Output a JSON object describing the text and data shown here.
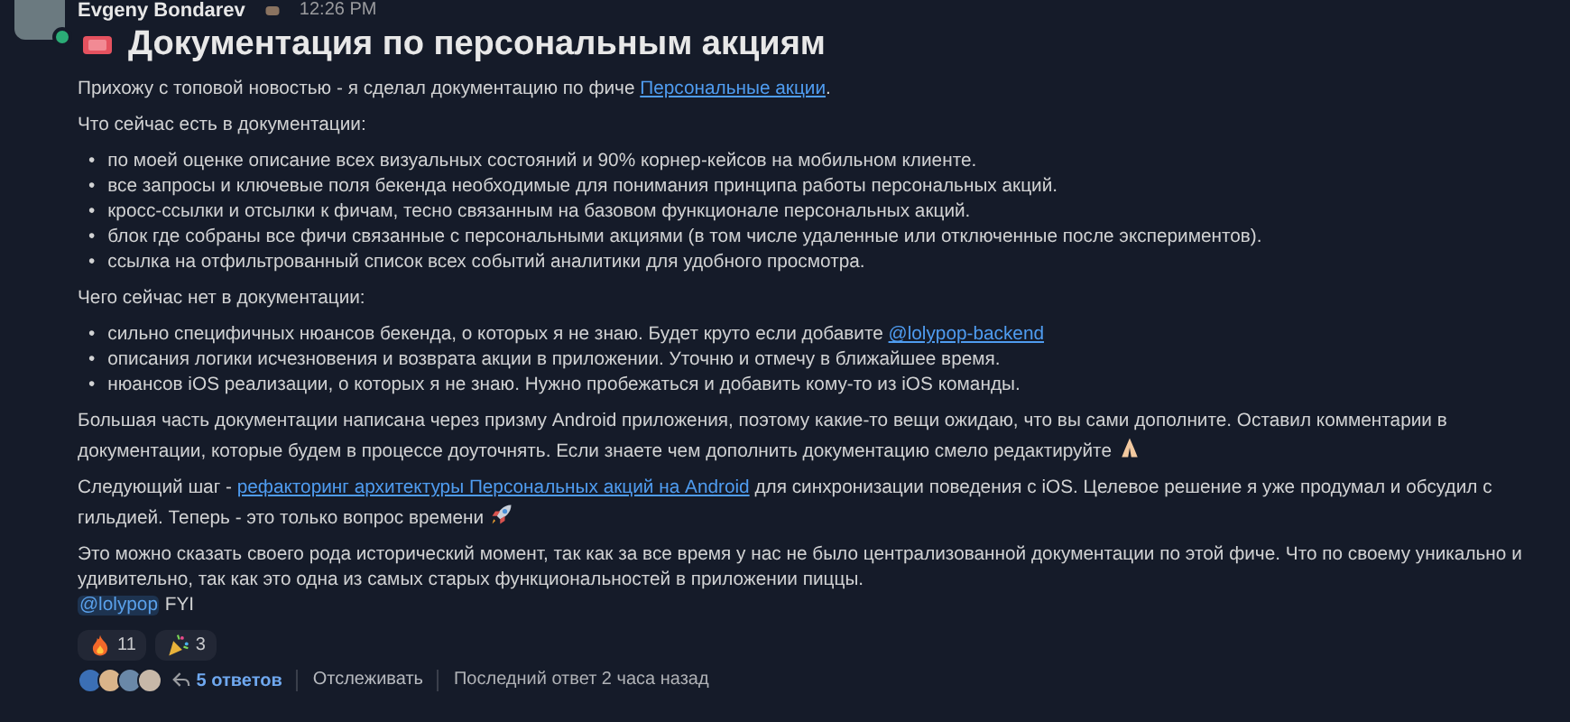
{
  "message": {
    "author": "Evgeny Bondarev",
    "time": "12:26 PM",
    "title": "Документация по персональным акциям",
    "blocks": [
      {
        "kind": "para",
        "segments": [
          {
            "kind": "text",
            "text": "Прихожу с топовой новостью - я сделал документацию по фиче "
          },
          {
            "kind": "link",
            "text": "Персональные акции"
          },
          {
            "kind": "text",
            "text": "."
          }
        ]
      },
      {
        "kind": "para",
        "segments": [
          {
            "kind": "text",
            "text": "Что сейчас есть в документации:"
          }
        ]
      },
      {
        "kind": "list",
        "marker": "•",
        "items": [
          [
            {
              "kind": "text",
              "text": "по моей оценке описание всех визуальных состояний и 90% корнер-кейсов на мобильном клиенте."
            }
          ],
          [
            {
              "kind": "text",
              "text": "все запросы и ключевые поля бекенда необходимые для понимания принципа работы персональных акций."
            }
          ],
          [
            {
              "kind": "text",
              "text": "кросс-ссылки и отсылки к фичам, тесно связанным на базовом функционале персональных акций."
            }
          ],
          [
            {
              "kind": "text",
              "text": "блок где собраны все фичи связанные с персональными акциями (в том числе удаленные или отключенные после экспериментов)."
            }
          ],
          [
            {
              "kind": "text",
              "text": "ссылка на отфильтрованный список всех событий аналитики для удобного просмотра."
            }
          ]
        ]
      },
      {
        "kind": "para",
        "segments": [
          {
            "kind": "text",
            "text": "Чего сейчас нет в документации:"
          }
        ]
      },
      {
        "kind": "list",
        "marker": "•",
        "items": [
          [
            {
              "kind": "text",
              "text": "сильно специфичных нюансов бекенда, о которых я не знаю. Будет круто если добавите "
            },
            {
              "kind": "link",
              "text": "@lolypop-backend"
            }
          ],
          [
            {
              "kind": "text",
              "text": "описания логики исчезновения и возврата акции в приложении. Уточню и отмечу в ближайшее время."
            }
          ],
          [
            {
              "kind": "text",
              "text": "нюансов iOS реализации, о которых я не знаю. Нужно пробежаться и добавить кому-то из iOS команды."
            }
          ]
        ]
      },
      {
        "kind": "para",
        "segments": [
          {
            "kind": "text",
            "text": "Большая часть документации написана через призму Android приложения, поэтому какие-то вещи ожидаю, что вы сами дополните. Оставил комментарии в документации, которые будем в процессе доуточнять. Если знаете чем дополнить документацию смело редактируйте "
          },
          {
            "kind": "pray"
          }
        ]
      },
      {
        "kind": "para",
        "segments": [
          {
            "kind": "text",
            "text": "Следующий шаг - "
          },
          {
            "kind": "link",
            "text": "рефакторинг архитектуры Персональных акций на Android"
          },
          {
            "kind": "text",
            "text": " для синхронизации поведения с iOS. Целевое решение я уже продумал и обсудил с гильдией. Теперь - это только вопрос времени "
          },
          {
            "kind": "rocket"
          }
        ]
      },
      {
        "kind": "para",
        "segments": [
          {
            "kind": "text",
            "text": "Это можно сказать своего рода исторический момент, так как за все время у нас не было централизованной документации по этой фиче. Что по своему уникально и удивительно, так как это одна из самых старых функциональностей в приложении пиццы."
          },
          {
            "kind": "break"
          },
          {
            "kind": "mention",
            "text": "@lolypop"
          },
          {
            "kind": "text",
            "text": " FYI"
          }
        ]
      }
    ],
    "reactions": [
      {
        "kind": "fire",
        "count": "11"
      },
      {
        "kind": "party",
        "count": "3"
      }
    ],
    "thread": {
      "replies": "5 ответов",
      "follow": "Отслеживать",
      "last_reply": "Последний ответ 2 часа назад"
    }
  }
}
